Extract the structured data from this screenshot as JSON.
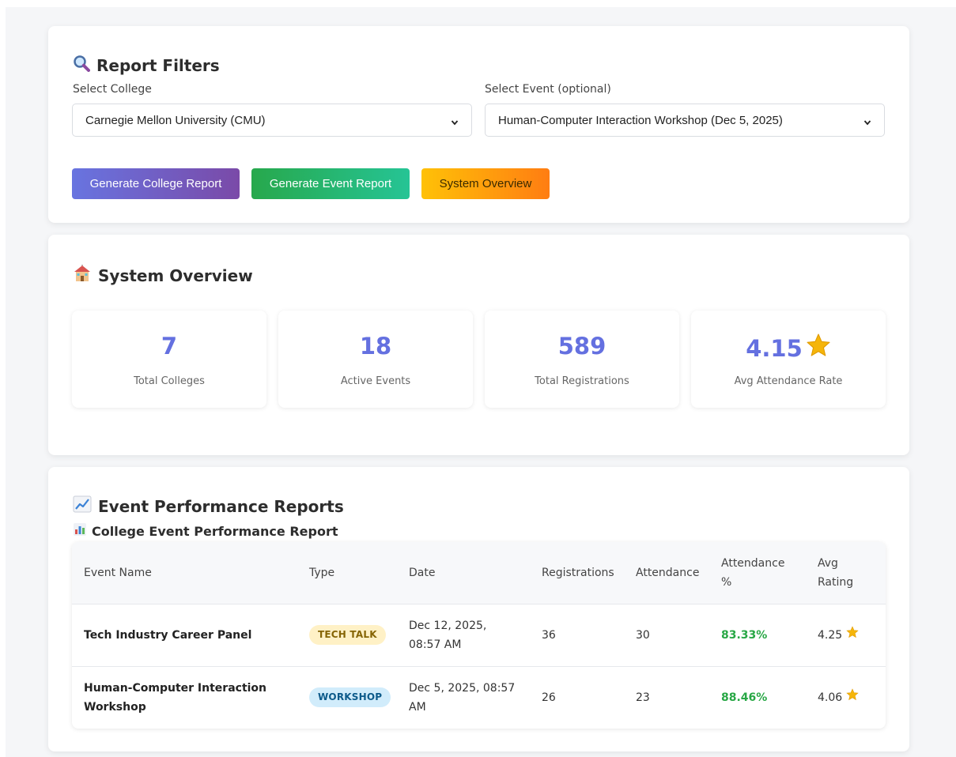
{
  "filters": {
    "title": "Report Filters",
    "title_icon": "magnifier-icon",
    "college_label": "Select College",
    "college_value": "Carnegie Mellon University (CMU)",
    "event_label": "Select Event (optional)",
    "event_value": "Human-Computer Interaction Workshop (Dec 5, 2025)",
    "buttons": {
      "college_report": "Generate College Report",
      "event_report": "Generate Event Report",
      "system_overview": "System Overview"
    }
  },
  "overview": {
    "title": "System Overview",
    "title_icon": "school-building-icon",
    "stats": [
      {
        "value": "7",
        "label": "Total Colleges"
      },
      {
        "value": "18",
        "label": "Active Events"
      },
      {
        "value": "589",
        "label": "Total Registrations"
      },
      {
        "value": "4.15",
        "label": "Avg Attendance Rate",
        "icon": "star-icon"
      }
    ]
  },
  "reports": {
    "title": "Event Performance Reports",
    "title_icon": "chart-increasing-icon",
    "subtitle": "College Event Performance Report",
    "subtitle_icon": "bar-chart-icon",
    "columns": [
      "Event Name",
      "Type",
      "Date",
      "Registrations",
      "Attendance",
      "Attendance %",
      "Avg Rating"
    ],
    "rows": [
      {
        "name": "Tech Industry Career Panel",
        "type": "TECH TALK",
        "date": "Dec 12, 2025, 08:57 AM",
        "registrations": "36",
        "attendance": "30",
        "attendance_pct": "83.33%",
        "rating": "4.25"
      },
      {
        "name": "Human-Computer Interaction Workshop",
        "type": "WORKSHOP",
        "date": "Dec 5, 2025, 08:57 AM",
        "registrations": "26",
        "attendance": "23",
        "attendance_pct": "88.46%",
        "rating": "4.06"
      }
    ]
  },
  "colors": {
    "stat_value": "#6470e0",
    "percent_green": "#28a745",
    "badge_tech_talk_bg": "#fff1c6",
    "badge_tech_talk_fg": "#856404",
    "badge_workshop_bg": "#d1ecfb",
    "badge_workshop_fg": "#0c5a8a",
    "star": "#f5b50a"
  }
}
